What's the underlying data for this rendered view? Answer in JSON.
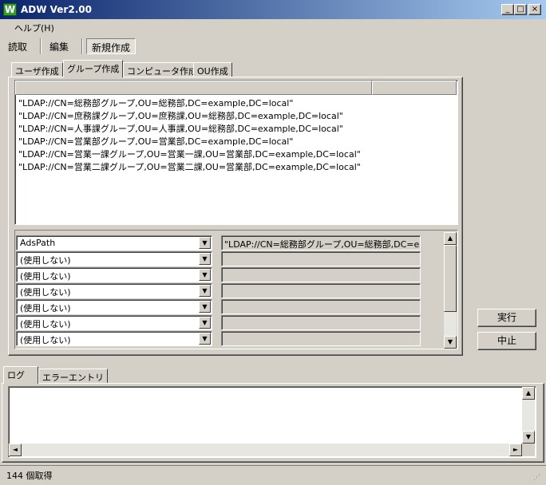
{
  "window": {
    "icon_letter": "W",
    "title": "ADW Ver2.00",
    "min_glyph": "_",
    "max_glyph": "□",
    "close_glyph": "×"
  },
  "menu": {
    "help": "ヘルプ(H)"
  },
  "toolbar": {
    "read": "読取",
    "edit": "編集",
    "new": "新規作成"
  },
  "tabs": [
    "ユーザ作成",
    "グループ作成",
    "コンピュータ作成",
    "OU作成"
  ],
  "ldap_list": [
    "\"LDAP://CN=総務部グループ,OU=総務部,DC=example,DC=local\"",
    "\"LDAP://CN=庶務課グループ,OU=庶務課,OU=総務部,DC=example,DC=local\"",
    "\"LDAP://CN=人事課グループ,OU=人事課,OU=総務部,DC=example,DC=local\"",
    "\"LDAP://CN=営業部グループ,OU=営業部,DC=example,DC=local\"",
    "\"LDAP://CN=営業一課グループ,OU=営業一課,OU=営業部,DC=example,DC=local\"",
    "\"LDAP://CN=営業二課グループ,OU=営業二課,OU=営業部,DC=example,DC=local\""
  ],
  "mapping": {
    "combos": [
      "AdsPath",
      "(使用しない)",
      "(使用しない)",
      "(使用しない)",
      "(使用しない)",
      "(使用しない)",
      "(使用しない)"
    ],
    "fields": [
      "\"LDAP://CN=総務部グループ,OU=総務部,DC=exa",
      "",
      "",
      "",
      "",
      "",
      ""
    ]
  },
  "buttons": {
    "run": "実行",
    "stop": "中止"
  },
  "bottom_tabs": [
    "ログ",
    "エラーエントリ"
  ],
  "status": {
    "text": "144 個取得"
  },
  "glyphs": {
    "up": "▲",
    "down": "▼",
    "left": "◄",
    "right": "►",
    "grip": "⋰"
  }
}
